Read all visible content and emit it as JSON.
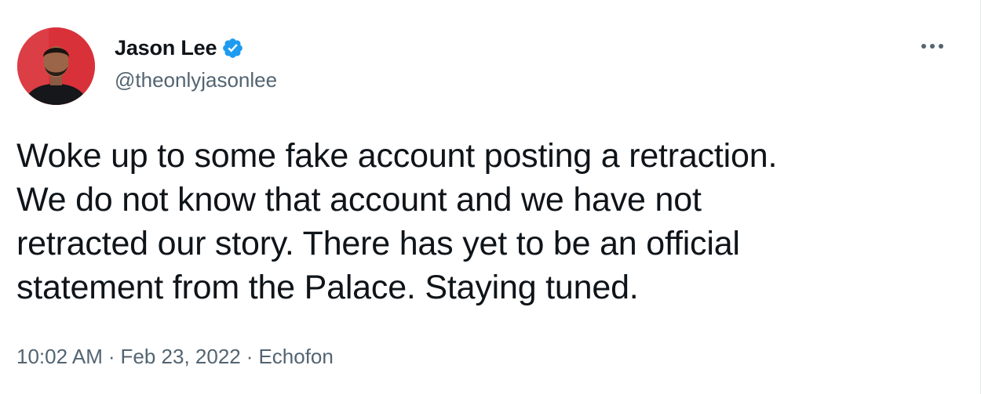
{
  "author": {
    "display_name": "Jason Lee",
    "handle": "@theonlyjasonlee",
    "verified": true
  },
  "tweet": {
    "text_lines": [
      "Woke up to some fake account posting a retraction.",
      "We do not know that account and we have not",
      "retracted our story. There has yet to be an official",
      "statement from the Palace. Staying tuned."
    ],
    "time": "10:02 AM",
    "date": "Feb 23, 2022",
    "source": "Echofon",
    "separator": "·"
  },
  "icons": {
    "verified": "verified-badge-icon",
    "more": "more-options-icon"
  },
  "colors": {
    "verified_blue": "#1d9bf0",
    "secondary_text": "#536471",
    "primary_text": "#0f1419",
    "avatar_background": "#d62a32"
  }
}
